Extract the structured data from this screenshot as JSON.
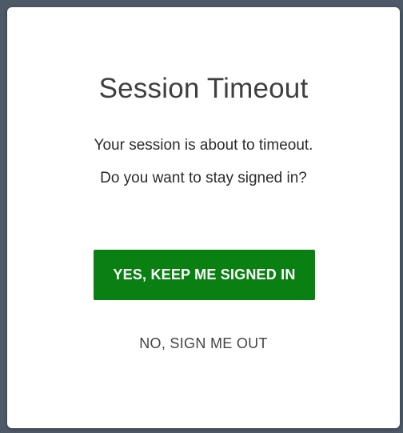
{
  "dialog": {
    "title": "Session Timeout",
    "message_line1": "Your session is about to timeout.",
    "message_line2": "Do you want to stay signed in?",
    "confirm_label": "YES, KEEP ME SIGNED IN",
    "cancel_label": "NO, SIGN ME OUT"
  },
  "colors": {
    "confirm_button_bg": "#0a7f12",
    "confirm_button_text": "#ffffff",
    "backdrop": "#4d5966",
    "dialog_bg": "#ffffff"
  }
}
